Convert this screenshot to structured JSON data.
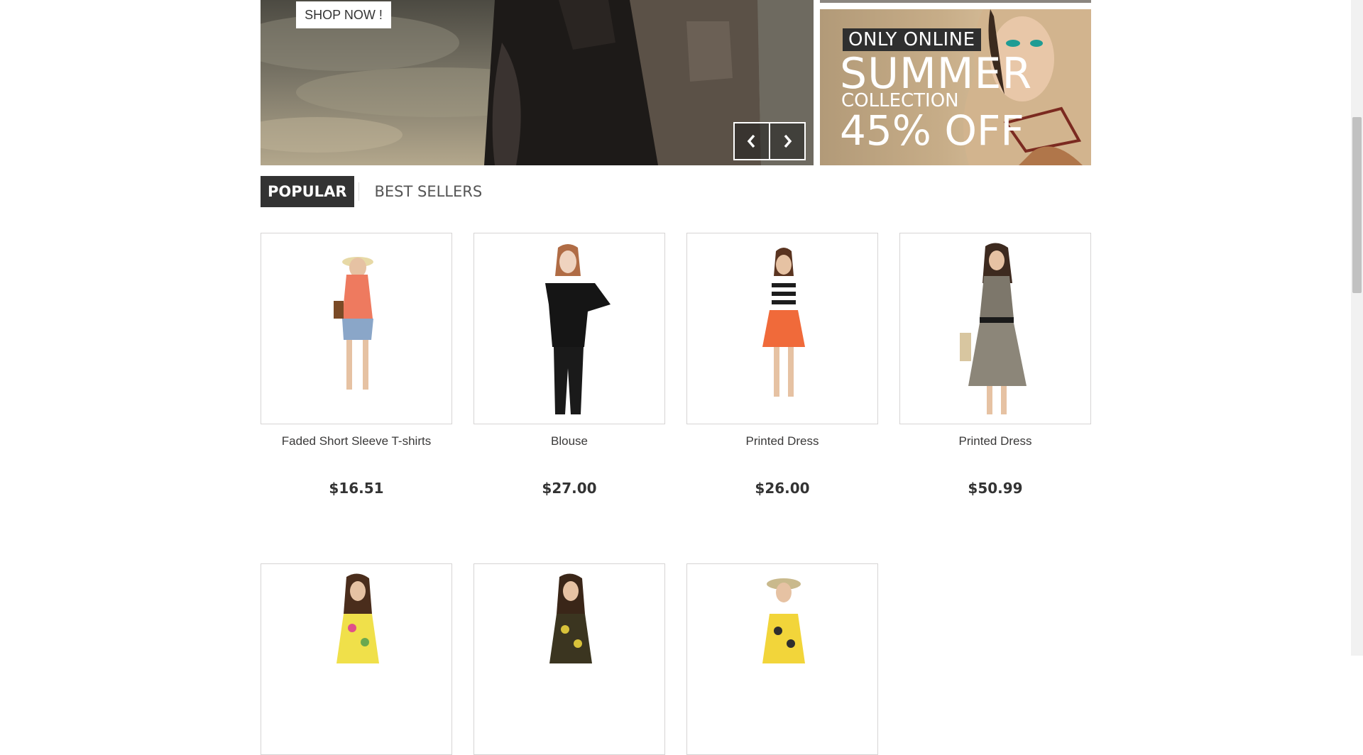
{
  "slider": {
    "shop_now_label": "SHOP NOW !",
    "prev_icon": "chevron-left-icon",
    "next_icon": "chevron-right-icon"
  },
  "banner": {
    "tag": "ONLY ONLINE",
    "headline": "SUMMER",
    "subline": "COLLECTION",
    "discount": "45% OFF"
  },
  "tabs": [
    {
      "label": "POPULAR",
      "active": true
    },
    {
      "label": "BEST SELLERS",
      "active": false
    }
  ],
  "products": [
    {
      "name": "Faded Short Sleeve T-shirts",
      "price": "$16.51"
    },
    {
      "name": "Blouse",
      "price": "$27.00"
    },
    {
      "name": "Printed Dress",
      "price": "$26.00"
    },
    {
      "name": "Printed Dress",
      "price": "$50.99"
    },
    {
      "name": "",
      "price": ""
    },
    {
      "name": "",
      "price": ""
    },
    {
      "name": "",
      "price": ""
    }
  ],
  "colors": {
    "dark": "#333333",
    "border": "#d6d4d4",
    "banner_bg": "#c7ad88"
  }
}
